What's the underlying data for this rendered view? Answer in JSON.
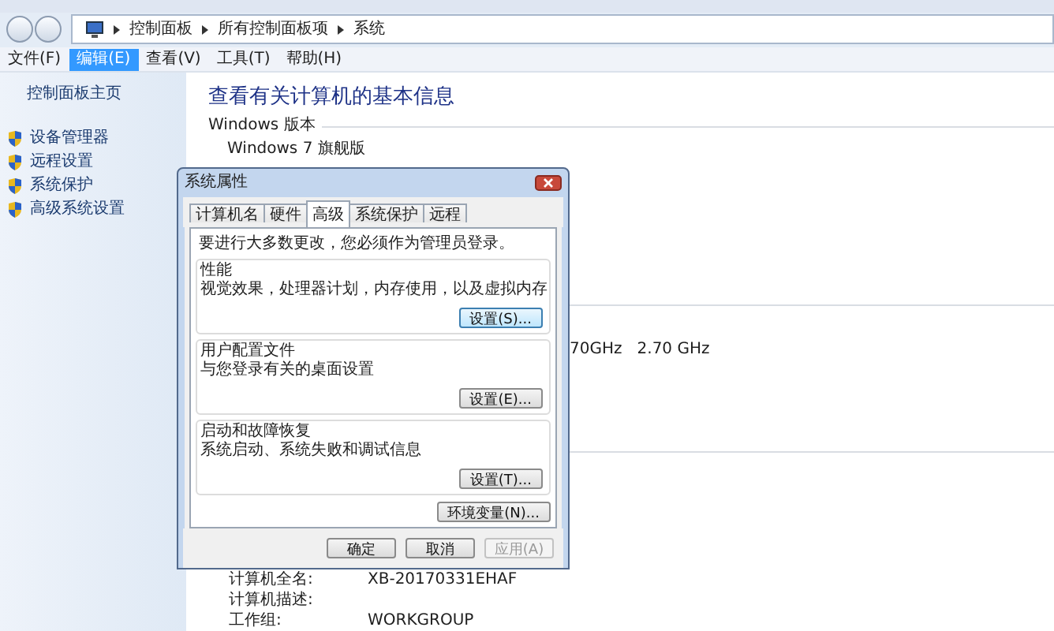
{
  "address_bar": {
    "path": [
      "控制面板",
      "所有控制面板项",
      "系统"
    ]
  },
  "menu": [
    {
      "label": "文件(F)",
      "selected": false
    },
    {
      "label": "编辑(E)",
      "selected": true
    },
    {
      "label": "查看(V)",
      "selected": false
    },
    {
      "label": "工具(T)",
      "selected": false
    },
    {
      "label": "帮助(H)",
      "selected": false
    }
  ],
  "sidebar": {
    "home": "控制面板主页",
    "items": [
      "设备管理器",
      "远程设置",
      "系统保护",
      "高级系统设置"
    ]
  },
  "content": {
    "heading": "查看有关计算机的基本信息",
    "edition_section": "Windows 版本",
    "edition": "Windows 7 旗舰版",
    "processor_fragment": "70GHz   2.70 GHz",
    "computer_rows": [
      {
        "label": "计算机全名:",
        "value": "XB-20170331EHAF"
      },
      {
        "label": "计算机描述:",
        "value": ""
      },
      {
        "label": "工作组:",
        "value": "WORKGROUP"
      }
    ]
  },
  "dialog": {
    "title": "系统属性",
    "tabs": [
      {
        "label": "计算机名",
        "selected": false
      },
      {
        "label": "硬件",
        "selected": false
      },
      {
        "label": "高级",
        "selected": true
      },
      {
        "label": "系统保护",
        "selected": false
      },
      {
        "label": "远程",
        "selected": false
      }
    ],
    "notice": "要进行大多数更改，您必须作为管理员登录。",
    "groups": [
      {
        "title": "性能",
        "description": "视觉效果，处理器计划，内存使用，以及虚拟内存",
        "button": "设置(S)...",
        "focused": true
      },
      {
        "title": "用户配置文件",
        "description": "与您登录有关的桌面设置",
        "button": "设置(E)...",
        "focused": false
      },
      {
        "title": "启动和故障恢复",
        "description": "系统启动、系统失败和调试信息",
        "button": "设置(T)...",
        "focused": false
      }
    ],
    "env_button": "环境变量(N)...",
    "buttons": [
      {
        "label": "确定",
        "disabled": false
      },
      {
        "label": "取消",
        "disabled": false
      },
      {
        "label": "应用(A)",
        "disabled": true
      }
    ]
  }
}
